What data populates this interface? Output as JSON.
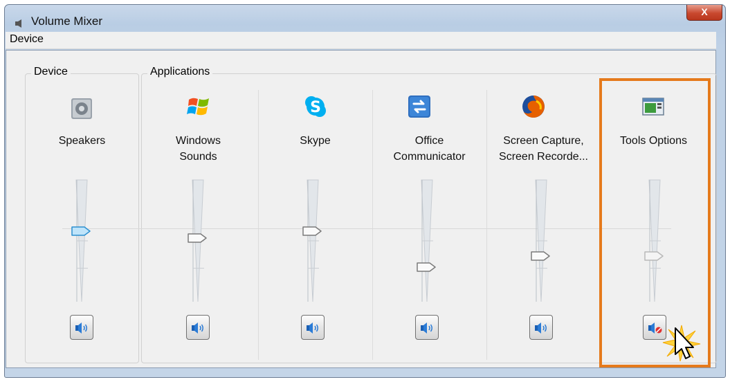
{
  "window": {
    "title": "Volume Mixer",
    "close_label": "X"
  },
  "menu": {
    "device": "Device"
  },
  "groups": {
    "device": "Device",
    "applications": "Applications"
  },
  "channels": [
    {
      "label1": "Speakers",
      "label2": "",
      "icon": "speaker-icon",
      "level": 0.58,
      "muted": false
    },
    {
      "label1": "Windows",
      "label2": "Sounds",
      "icon": "windows-logo-icon",
      "level": 0.52,
      "muted": false
    },
    {
      "label1": "Skype",
      "label2": "",
      "icon": "skype-icon",
      "level": 0.58,
      "muted": false
    },
    {
      "label1": "Office",
      "label2": "Communicator",
      "icon": "office-communicator-icon",
      "level": 0.29,
      "muted": false
    },
    {
      "label1": "Screen Capture,",
      "label2": "Screen Recorde...",
      "icon": "firefox-icon",
      "level": 0.38,
      "muted": false
    },
    {
      "label1": "Tools Options",
      "label2": "",
      "icon": "tools-options-icon",
      "level": 0.38,
      "muted": true
    }
  ]
}
